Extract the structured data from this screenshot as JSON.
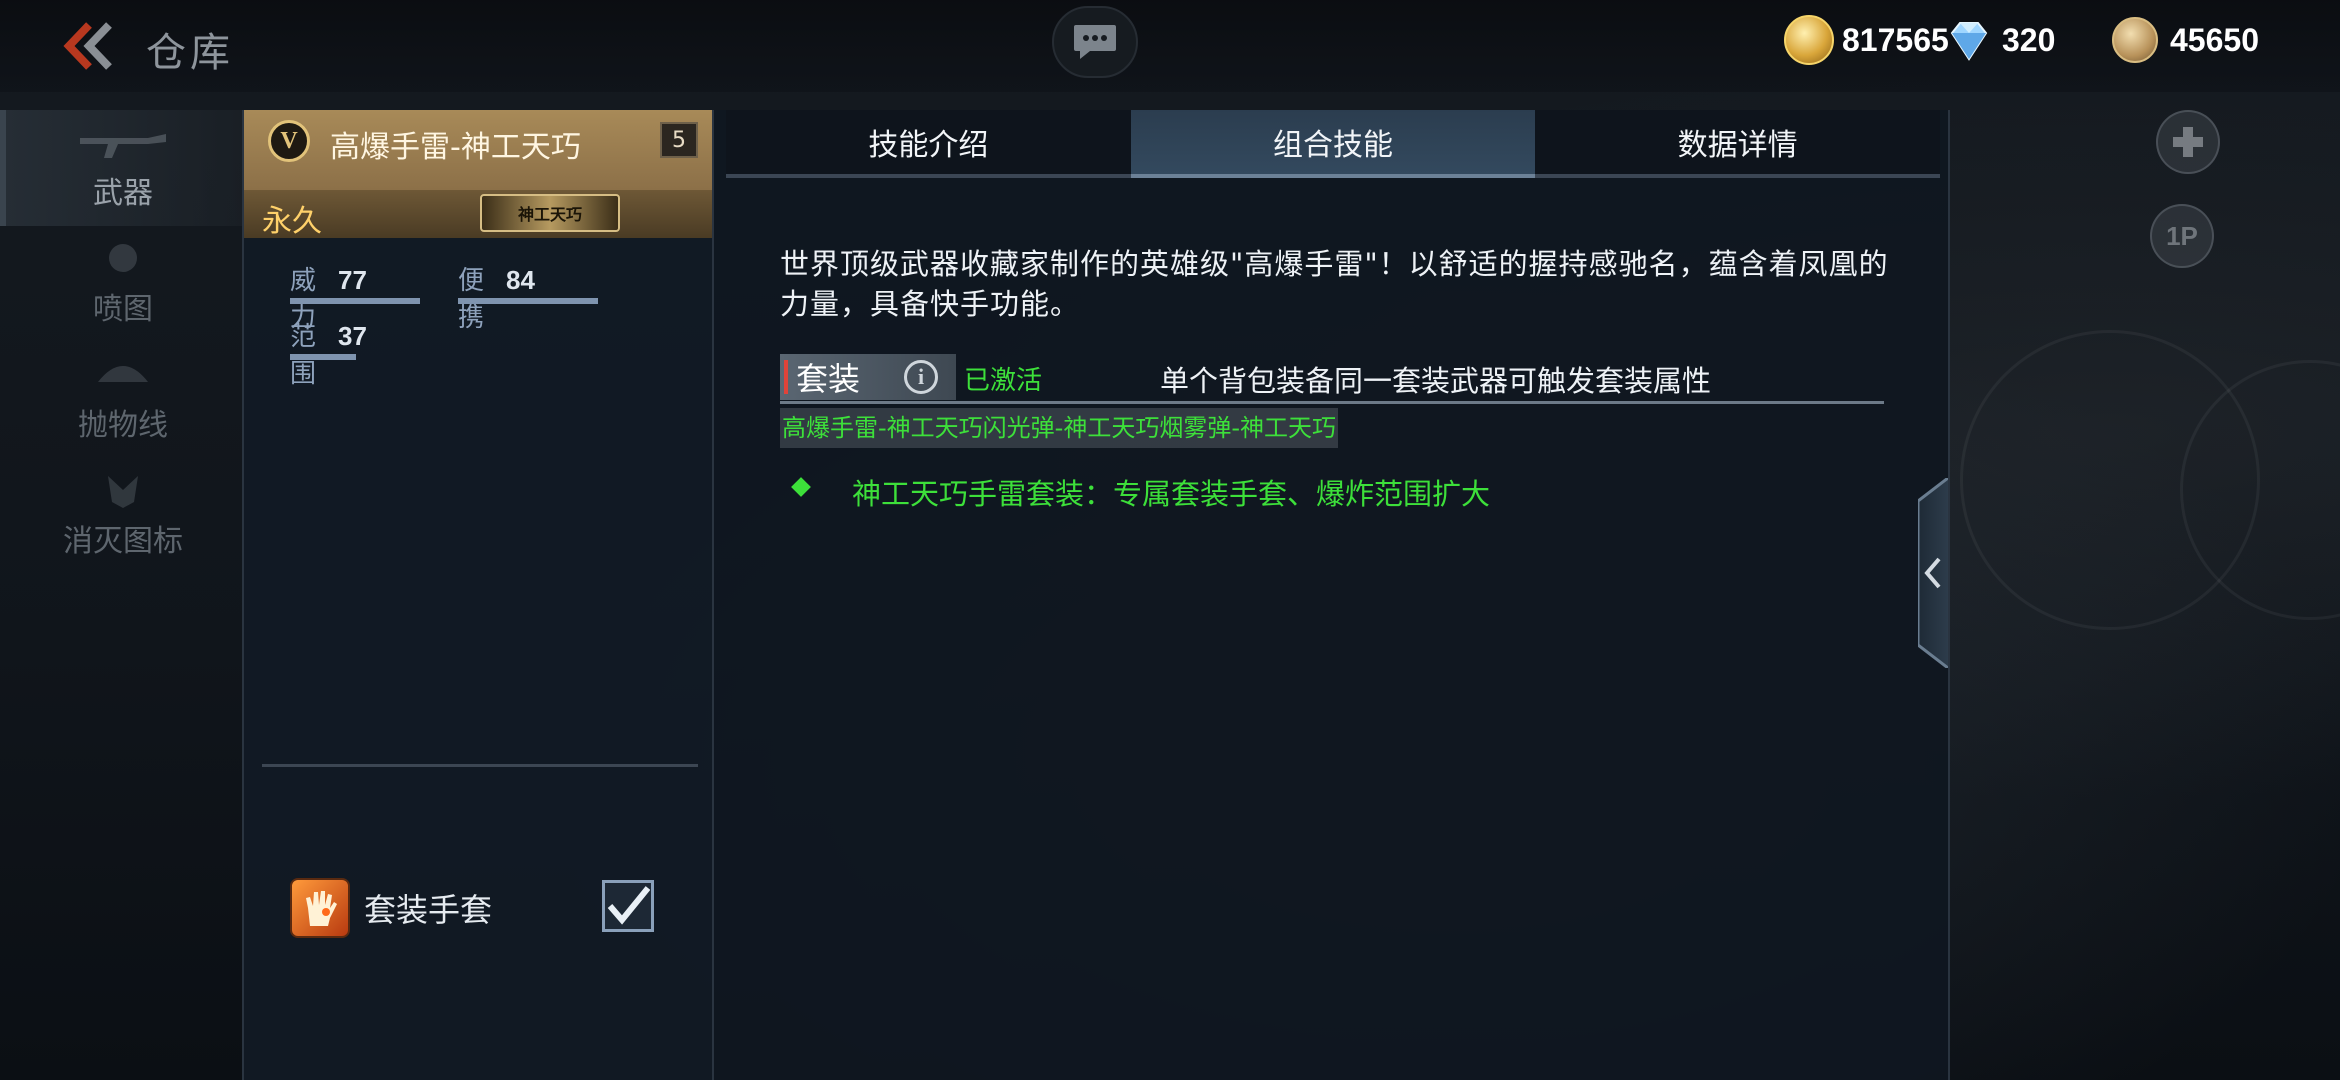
{
  "header": {
    "title": "仓库",
    "currencies": [
      {
        "icon": "gold-coin-icon",
        "amount": "817565"
      },
      {
        "icon": "diamond-icon",
        "amount": "320"
      },
      {
        "icon": "medal-coin-icon",
        "amount": "45650"
      }
    ]
  },
  "sidebar": {
    "items": [
      {
        "label": "武器",
        "icon": "rifle-icon",
        "active": true
      },
      {
        "label": "喷图",
        "icon": "spray-icon",
        "active": false
      },
      {
        "label": "抛物线",
        "icon": "parachute-icon",
        "active": false
      },
      {
        "label": "消灭图标",
        "icon": "kill-icon",
        "active": false
      }
    ]
  },
  "item": {
    "grade": "V",
    "name": "高爆手雷-神工天巧",
    "level": "5",
    "duration": "永久",
    "badge": "神工天巧",
    "stats": [
      {
        "name": "威力",
        "value": "77"
      },
      {
        "name": "便携",
        "value": "84"
      },
      {
        "name": "范围",
        "value": "37"
      }
    ],
    "equip_label": "套装手套",
    "equip_checked": true
  },
  "tabs": [
    {
      "label": "技能介绍",
      "active": false
    },
    {
      "label": "组合技能",
      "active": true
    },
    {
      "label": "数据详情",
      "active": false
    }
  ],
  "content": {
    "description": "世界顶级武器收藏家制作的英雄级\"高爆手雷\"！以舒适的握持感驰名，蕴含着凤凰的力量，具备快手功能。",
    "set_label": "套装",
    "set_status": "已激活",
    "set_hint": "单个背包装备同一套装武器可触发套装属性",
    "set_members": "高爆手雷-神工天巧闪光弹-神工天巧烟雾弹-神工天巧",
    "bonus": "神工天巧手雷套装：专属套装手套、爆炸范围扩大"
  },
  "colors": {
    "accent_green": "#3de03a",
    "gold": "#a88a58",
    "panel": "#121a24"
  }
}
